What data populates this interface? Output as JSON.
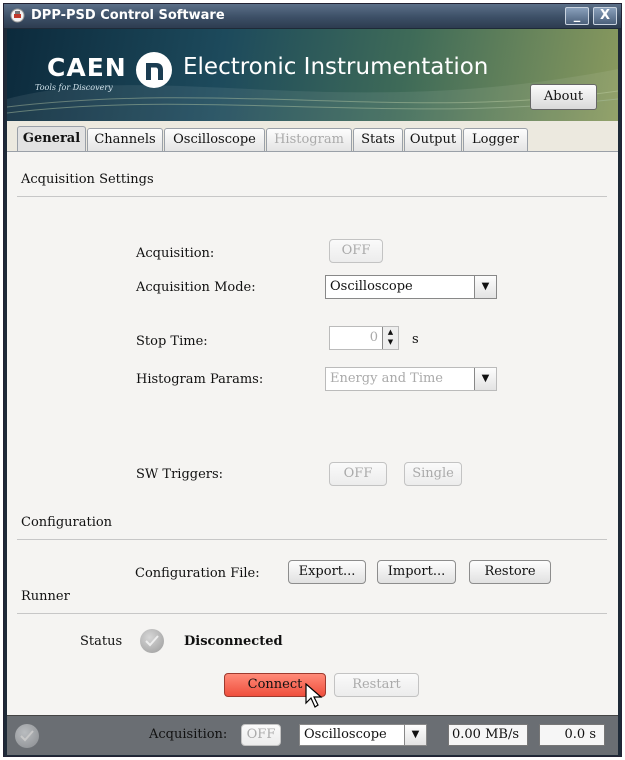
{
  "window": {
    "title": "DPP-PSD Control Software",
    "minimize_label": "_",
    "close_label": "X"
  },
  "banner": {
    "brand": "CAEN",
    "tagline": "Tools for Discovery",
    "title": "Electronic Instrumentation",
    "about_label": "About"
  },
  "tabs": [
    {
      "label": "General",
      "state": "active"
    },
    {
      "label": "Channels",
      "state": "normal"
    },
    {
      "label": "Oscilloscope",
      "state": "normal"
    },
    {
      "label": "Histogram",
      "state": "disabled"
    },
    {
      "label": "Stats",
      "state": "normal"
    },
    {
      "label": "Output",
      "state": "normal"
    },
    {
      "label": "Logger",
      "state": "normal"
    }
  ],
  "acquisition_settings": {
    "heading": "Acquisition Settings",
    "acquisition": {
      "label": "Acquisition:",
      "button": "OFF"
    },
    "mode": {
      "label": "Acquisition Mode:",
      "value": "Oscilloscope"
    },
    "stop_time": {
      "label": "Stop Time:",
      "value": "0",
      "unit": "s"
    },
    "histogram_params": {
      "label": "Histogram Params:",
      "value": "Energy and Time"
    },
    "sw_triggers": {
      "label": "SW Triggers:",
      "off_button": "OFF",
      "single_button": "Single"
    }
  },
  "configuration": {
    "heading": "Configuration",
    "file_label": "Configuration File:",
    "export_label": "Export...",
    "import_label": "Import...",
    "restore_label": "Restore"
  },
  "runner": {
    "heading": "Runner",
    "status_label": "Status",
    "status_value": "Disconnected",
    "connect_label": "Connect",
    "restart_label": "Restart"
  },
  "bottom_bar": {
    "acquisition_label": "Acquisition:",
    "acquisition_button": "OFF",
    "mode_value": "Oscilloscope",
    "rate": "0.00 MB/s",
    "time": "0.0 s"
  },
  "colors": {
    "connect_button": "#ef4f3d",
    "bottom_bar": "#6a6e73",
    "title_bar": "#3c4f66"
  }
}
